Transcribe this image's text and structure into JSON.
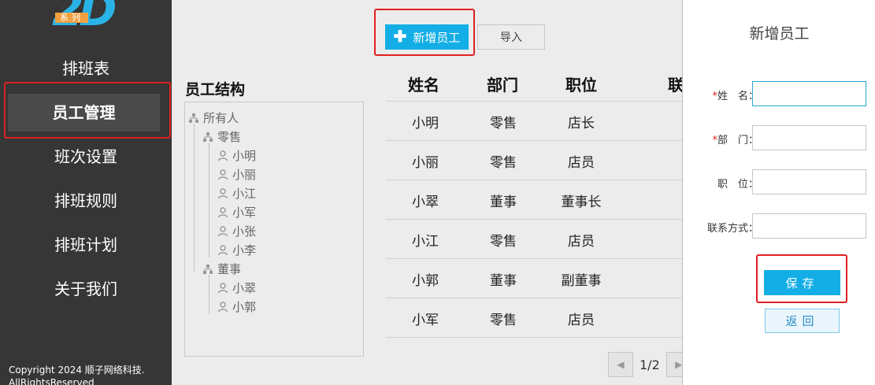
{
  "sidebar": {
    "logo_text": "2D",
    "logo_tag": "系列",
    "items": [
      {
        "label": "排班表"
      },
      {
        "label": "员工管理"
      },
      {
        "label": "班次设置"
      },
      {
        "label": "排班规则"
      },
      {
        "label": "排班计划"
      },
      {
        "label": "关于我们"
      }
    ],
    "copyright": "Copyright 2024 顺子网络科技. AllRightsReserved",
    "active_item": "员工管理"
  },
  "toolbar": {
    "add_label": "新增员工",
    "import_label": "导入"
  },
  "tree": {
    "title": "员工结构",
    "root": "所有人",
    "groups": [
      {
        "name": "零售",
        "members": [
          "小明",
          "小丽",
          "小江",
          "小军",
          "小张",
          "小李"
        ]
      },
      {
        "name": "董事",
        "members": [
          "小翠",
          "小郭"
        ]
      }
    ]
  },
  "table": {
    "headers": [
      "姓名",
      "部门",
      "职位",
      "联"
    ],
    "rows": [
      [
        "小明",
        "零售",
        "店长"
      ],
      [
        "小丽",
        "零售",
        "店员"
      ],
      [
        "小翠",
        "董事",
        "董事长"
      ],
      [
        "小江",
        "零售",
        "店员"
      ],
      [
        "小郭",
        "董事",
        "副董事"
      ],
      [
        "小军",
        "零售",
        "店员"
      ]
    ],
    "pagination": "1/2"
  },
  "form": {
    "title": "新增员工",
    "required_mark": "*",
    "name_label": "姓　名：",
    "dept_label": "部　门：",
    "position_label": "职　位：",
    "contact_label": "联系方式：",
    "name_value": "",
    "dept_value": "",
    "position_value": "",
    "contact_value": "",
    "save_label": "保存",
    "back_label": "返回"
  },
  "colors": {
    "sidebar_bg": "#363636",
    "accent": "#13aee6",
    "highlight": "#e02020"
  }
}
